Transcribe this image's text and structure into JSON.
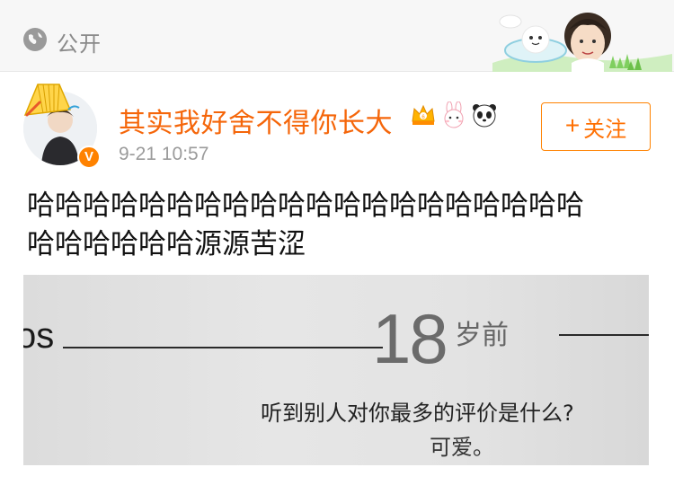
{
  "visibility": {
    "label": "公开",
    "icon": "globe-icon"
  },
  "post": {
    "author": {
      "name": "其实我好舍不得你长大",
      "verified_badge": "V",
      "badge_icons": [
        "crown-badge-icon",
        "bunny-badge-icon",
        "panda-badge-icon"
      ]
    },
    "timestamp": "9-21 10:57",
    "follow_button": {
      "label": "关注",
      "icon": "plus-icon"
    },
    "text_line1": "哈哈哈哈哈哈哈哈哈哈哈哈哈哈哈哈哈哈哈哈",
    "text_line2": "哈哈哈哈哈哈源源苦涩",
    "image": {
      "prefix": "os",
      "age": "18",
      "age_suffix": "岁前",
      "question": "听到别人对你最多的评价是什么?",
      "answer": "可爱。"
    }
  },
  "colors": {
    "accent": "#ff8200",
    "username": "#f5660a",
    "meta": "#9b9b9b"
  }
}
